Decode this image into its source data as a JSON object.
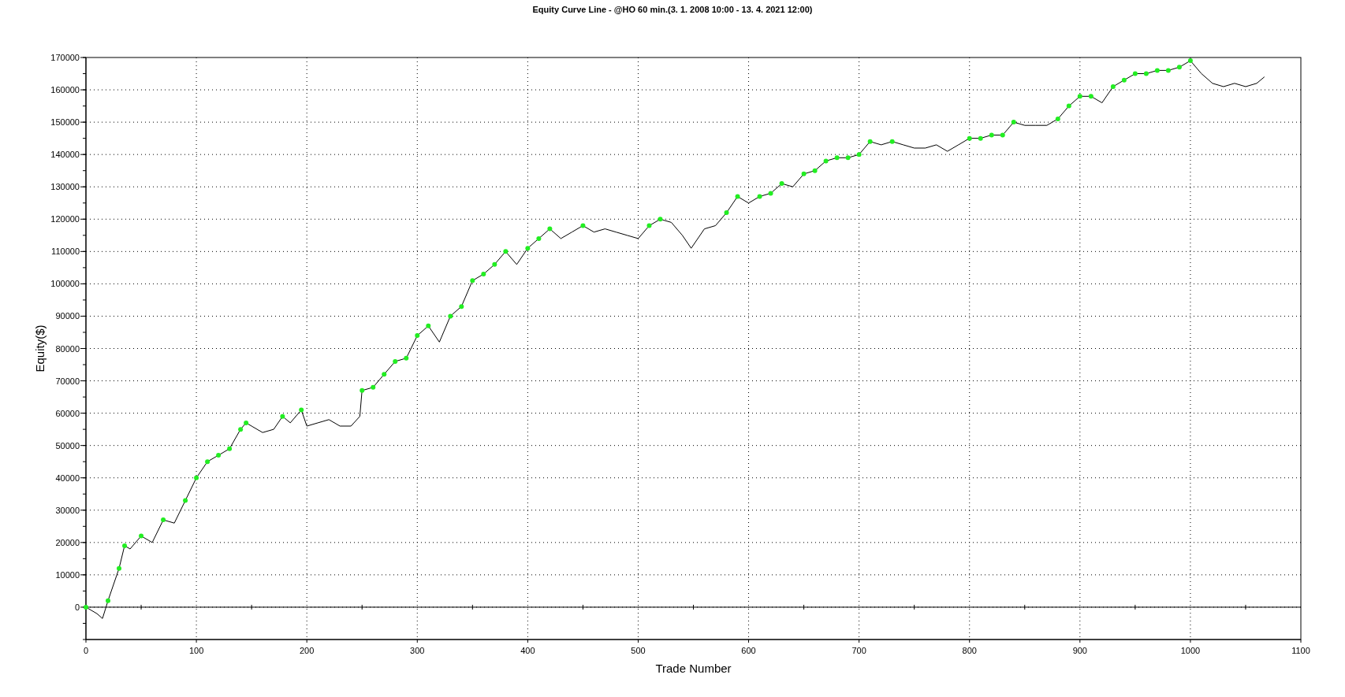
{
  "chart": {
    "chart_data": {
      "type": "line",
      "title": "Equity Curve Line - @HO 60 min.(3. 1. 2008 10:00 - 13. 4. 2021 12:00)",
      "xlabel": "Trade Number",
      "ylabel": "Equity($)",
      "x": [
        0,
        10,
        15,
        20,
        30,
        35,
        40,
        50,
        60,
        70,
        80,
        90,
        100,
        110,
        120,
        130,
        140,
        145,
        150,
        160,
        170,
        178,
        185,
        195,
        200,
        210,
        220,
        230,
        240,
        248,
        250,
        260,
        270,
        280,
        290,
        300,
        310,
        320,
        330,
        340,
        350,
        360,
        370,
        380,
        390,
        400,
        410,
        420,
        430,
        440,
        450,
        460,
        470,
        480,
        490,
        500,
        510,
        520,
        530,
        540,
        548,
        560,
        570,
        580,
        590,
        600,
        610,
        620,
        630,
        640,
        650,
        660,
        670,
        680,
        690,
        700,
        710,
        720,
        730,
        740,
        750,
        760,
        770,
        780,
        790,
        800,
        810,
        820,
        830,
        840,
        850,
        860,
        870,
        880,
        890,
        900,
        910,
        920,
        930,
        940,
        950,
        960,
        970,
        980,
        990,
        1000,
        1010,
        1020,
        1030,
        1040,
        1050,
        1060,
        1067
      ],
      "series": [
        {
          "color": "#000000",
          "values": [
            0,
            -2000,
            -3500,
            2000,
            12000,
            19000,
            18000,
            22000,
            20000,
            27000,
            26000,
            33000,
            40000,
            45000,
            47000,
            49000,
            55000,
            57000,
            56000,
            54000,
            55000,
            59000,
            57000,
            61000,
            56000,
            57000,
            58000,
            56000,
            56000,
            59000,
            67000,
            68000,
            72000,
            76000,
            77000,
            84000,
            87000,
            82000,
            90000,
            93000,
            101000,
            103000,
            106000,
            110000,
            106000,
            111000,
            114000,
            117000,
            114000,
            116000,
            118000,
            116000,
            117000,
            116000,
            115000,
            114000,
            118000,
            120000,
            119000,
            115000,
            111000,
            117000,
            118000,
            122000,
            127000,
            125000,
            127000,
            128000,
            131000,
            130000,
            134000,
            135000,
            138000,
            139000,
            139000,
            140000,
            144000,
            143000,
            144000,
            143000,
            142000,
            142000,
            143000,
            141000,
            143000,
            145000,
            145000,
            146000,
            146000,
            150000,
            149000,
            149000,
            149000,
            151000,
            155000,
            158000,
            158000,
            156000,
            161000,
            163000,
            165000,
            165000,
            166000,
            166000,
            167000,
            169000,
            165000,
            162000,
            161000,
            162000,
            161000,
            162000,
            164000
          ]
        }
      ],
      "grid": true,
      "xlim": [
        0,
        1100
      ],
      "ylim": [
        -10000,
        170000
      ],
      "xticks": [
        0,
        100,
        200,
        300,
        400,
        500,
        600,
        700,
        800,
        900,
        1000,
        1100
      ],
      "yticks": [
        0,
        10000,
        20000,
        30000,
        40000,
        50000,
        60000,
        70000,
        80000,
        90000,
        100000,
        110000,
        120000,
        130000,
        140000,
        150000,
        160000,
        170000
      ]
    }
  }
}
